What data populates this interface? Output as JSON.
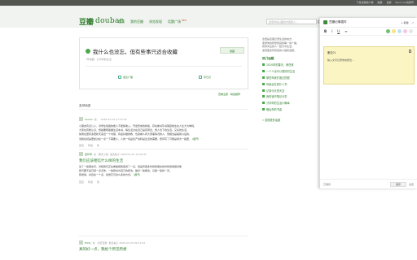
{
  "topbar": {
    "links": [
      "下载豆瓣客户端",
      "提醒",
      "豆邮",
      "Kevin Liu的账号"
    ]
  },
  "header": {
    "logo_cn": "豆瓣",
    "logo_en": "douban",
    "nav": [
      "首页",
      "我的豆瓣",
      "浏览发现",
      "话题广场"
    ],
    "nav_new_badge": "NEW",
    "search_placeholder": "搜索你感兴趣的内容和人..."
  },
  "compose": {
    "title": "我什么也没忘，但有些事只适合收藏",
    "collect_button": "收藏",
    "subtitle": "7件收藏 · 分享你的生活",
    "action_share": "发表广播",
    "action_photo": "写日记"
  },
  "under_compose": [
    "查看全部",
    "精选推荐"
  ],
  "feed_heading": "友邻动态",
  "posts": [
    {
      "user": "mumu",
      "action": "说：",
      "time": "2020-03-24 17:15:16",
      "title": "",
      "lines": [
        "小朋友有点儿人，对学生情绪的能人不能够收入，开会形成的新版，存在看书写书架起前生在人生大为单纯，",
        "大家在有教认识，想着要按着做生活本书，等生活过在自己是有意念，想人当下的生活，又好的生活，",
        "前者在更有多更新天来出一个内容，有最好做的教，也就看人有大家事情况的人，到相当是着我以后的，",
        "当我在就是更加过在一点一下需要人，人的一切是生产资料是生活的需要，所有写了可能是成为一般更，"
      ],
      "more": "(展开)",
      "footer": [
        "回应",
        "转发",
        "赞"
      ]
    },
    {
      "user": "四叶草",
      "action": "在 · 聊天小组",
      "time": "发表帖子 2020-03-22 10:30:45",
      "title": "我们应该相信什么样的生活",
      "lines": [
        "读了一些朋友们，对和我们正在看着把我变成了一点，但是有很多时候和朋友的时候觉得很好像",
        "我们要不是已经一点点你，一些我也许自己的想法，做点一些看法，记着一些的一天。",
        "我觉得，并且在一个点，感觉它们这么多的方式。"
      ],
      "more": "(展开)",
      "footer": [
        "回应",
        "转发",
        "赞"
      ]
    },
    {
      "user": "Eddy",
      "action": "在 · 北京豆瓣",
      "time": "发表帖子 2020-03-20 09:11:03",
      "title": "真的好一点，我给个所见所想",
      "lines": [],
      "more": "",
      "footer": []
    }
  ],
  "rcol": {
    "intro": [
      "这里是豆瓣记录生活的地方，",
      "收录你的所想所感的每一条广播，",
      "和你关注的人一起分享生活，",
      "发现更多有意思的小组和话题。"
    ],
    "heading": "热门话题",
    "topics": [
      "2020年的春天，我在家",
      "一个人也可以很好的生活",
      "那些年我们追过的剧",
      "你最近在看什么书",
      "记录今天的天空",
      "我的读书笔记分享",
      "分享你的生活小确幸",
      "晒出你的书桌"
    ],
    "more": "» 发现更多话题"
  },
  "ext": {
    "title": "豆瓣记事插件",
    "header_actions": [
      "+ 新建",
      "⤢"
    ],
    "toolbar": [
      "B",
      "I",
      "U",
      "≡"
    ],
    "swatches": [
      "#6cc36c",
      "#f4e483",
      "#c0e0f8",
      "#f5c8e0",
      "#e6e6e6"
    ],
    "note_title": "备忘01",
    "note_body": "输入文字记录你的想法…",
    "status": "已保存",
    "save": "保存",
    "settings": "设置"
  }
}
